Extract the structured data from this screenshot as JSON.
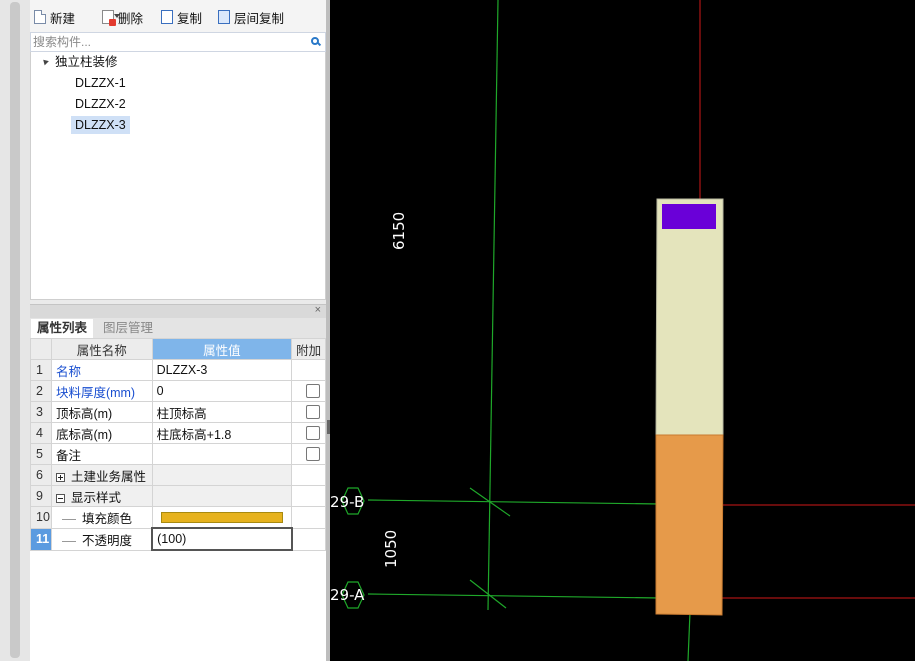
{
  "toolbar": {
    "new_label": "新建",
    "delete_label": "删除",
    "copy_label": "复制",
    "floor_copy_label": "层间复制",
    "more": "▸▸"
  },
  "search": {
    "placeholder": "搜索构件..."
  },
  "tree": {
    "root_label": "独立柱装修",
    "items": [
      "DLZZX-1",
      "DLZZX-2",
      "DLZZX-3"
    ],
    "selected": "DLZZX-3"
  },
  "properties_panel": {
    "close": "×",
    "tabs": [
      "属性列表",
      "图层管理"
    ],
    "columns": [
      "属性名称",
      "属性值",
      "附加"
    ],
    "rows": [
      {
        "index": "1",
        "name": "名称",
        "value": "DLZZX-3"
      },
      {
        "index": "2",
        "name": "块料厚度(mm)",
        "value": "0"
      },
      {
        "index": "3",
        "name": "顶标高(m)",
        "value": "柱顶标高"
      },
      {
        "index": "4",
        "name": "底标高(m)",
        "value": "柱底标高+1.8"
      },
      {
        "index": "5",
        "name": "备注",
        "value": ""
      },
      {
        "index": "6",
        "name": "土建业务属性",
        "value": ""
      },
      {
        "index": "9",
        "name": "显示样式",
        "value": ""
      },
      {
        "index": "10",
        "name": "填充颜色",
        "value": ""
      },
      {
        "index": "11",
        "name": "不透明度",
        "value": "(100)"
      }
    ],
    "fill_color": "#e6b21e"
  },
  "canvas": {
    "dimension_top": "6150",
    "dimension_bottom": "1050",
    "axis_labels": [
      "29-B",
      "29-A"
    ],
    "colors": {
      "background": "#000000",
      "grid_green": "#1fa82a",
      "grid_red": "#d01818",
      "column_cap": "#6a00d8",
      "column_upper": "#e4e4bc",
      "column_lower": "#e69a4a"
    }
  }
}
